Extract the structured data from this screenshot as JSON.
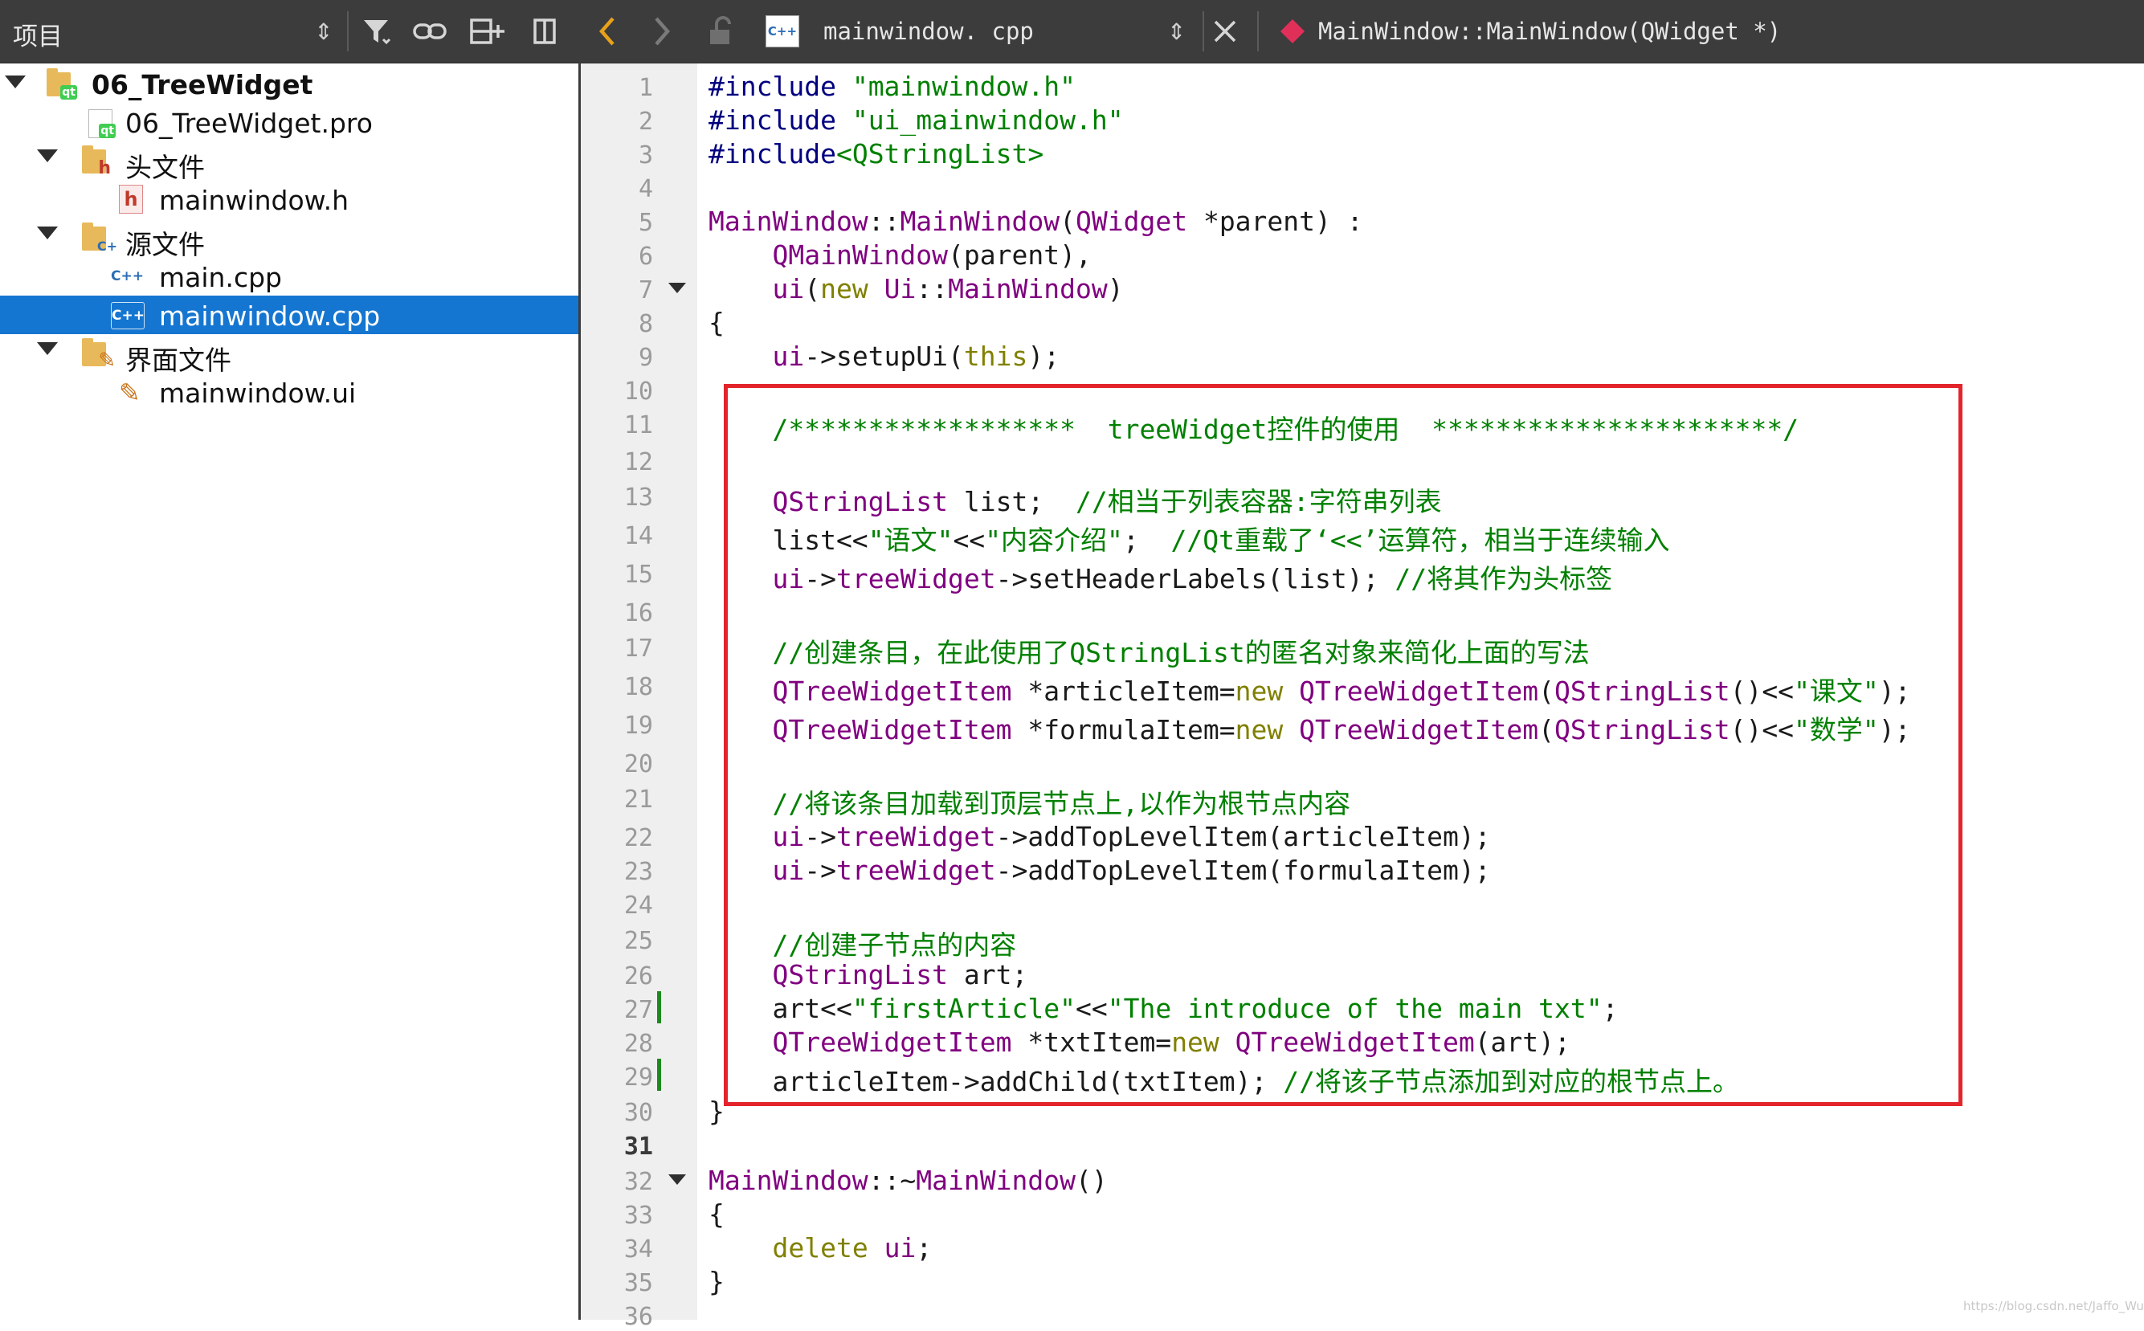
{
  "project_pane": {
    "title": "项目",
    "toolbar_icons": [
      "sort-updown-icon",
      "filter-icon",
      "link-icon",
      "split-add-icon",
      "close-sidebar-icon"
    ]
  },
  "tree": [
    {
      "label": "06_TreeWidget",
      "icon": "qt-project-icon",
      "bold": true,
      "expanded": true
    },
    {
      "label": "06_TreeWidget.pro",
      "icon": "pro-file-icon"
    },
    {
      "label": "头文件",
      "icon": "header-folder-icon",
      "expanded": true
    },
    {
      "label": "mainwindow.h",
      "icon": "header-file-icon"
    },
    {
      "label": "源文件",
      "icon": "source-folder-icon",
      "expanded": true
    },
    {
      "label": "main.cpp",
      "icon": "cpp-file-icon"
    },
    {
      "label": "mainwindow.cpp",
      "icon": "cpp-file-icon",
      "selected": true
    },
    {
      "label": "界面文件",
      "icon": "forms-folder-icon",
      "expanded": true
    },
    {
      "label": "mainwindow.ui",
      "icon": "ui-file-icon"
    }
  ],
  "editor": {
    "file_badge": "C++",
    "file_name": "mainwindow. cpp",
    "symbol": "MainWindow::MainWindow(QWidget *)",
    "current_line": 31,
    "line_numbers": [
      "1",
      "2",
      "3",
      "4",
      "5",
      "6",
      "7",
      "8",
      "9",
      "10",
      "11",
      "12",
      "13",
      "14",
      "15",
      "16",
      "17",
      "18",
      "19",
      "20",
      "21",
      "22",
      "23",
      "24",
      "25",
      "26",
      "27",
      "28",
      "29",
      "30",
      "31",
      "32",
      "33",
      "34",
      "35",
      "36"
    ],
    "code": [
      "#include \"mainwindow.h\"",
      "#include \"ui_mainwindow.h\"",
      "#include<QStringList>",
      "",
      "MainWindow::MainWindow(QWidget *parent) :",
      "    QMainWindow(parent),",
      "    ui(new Ui::MainWindow)",
      "{",
      "    ui->setupUi(this);",
      "",
      "    /******************  treeWidget控件的使用  **********************/",
      "",
      "    QStringList list;  //相当于列表容器:字符串列表",
      "    list<<\"语文\"<<\"内容介绍\";  //Qt重载了‘<<’运算符，相当于连续输入",
      "    ui->treeWidget->setHeaderLabels(list); //将其作为头标签",
      "",
      "    //创建条目，在此使用了QStringList的匿名对象来简化上面的写法",
      "    QTreeWidgetItem *articleItem=new QTreeWidgetItem(QStringList()<<\"课文\");",
      "    QTreeWidgetItem *formulaItem=new QTreeWidgetItem(QStringList()<<\"数学\");",
      "",
      "    //将该条目加载到顶层节点上,以作为根节点内容",
      "    ui->treeWidget->addTopLevelItem(articleItem);",
      "    ui->treeWidget->addTopLevelItem(formulaItem);",
      "",
      "    //创建子节点的内容",
      "    QStringList art;",
      "    art<<\"firstArticle\"<<\"The introduce of the main txt\";",
      "    QTreeWidgetItem *txtItem=new QTreeWidgetItem(art);",
      "    articleItem->addChild(txtItem); //将该子节点添加到对应的根节点上。",
      "}",
      "",
      "MainWindow::~MainWindow()",
      "{",
      "    delete ui;",
      "}",
      ""
    ]
  },
  "watermark": "https://blog.csdn.net/Jaffo_Wu"
}
